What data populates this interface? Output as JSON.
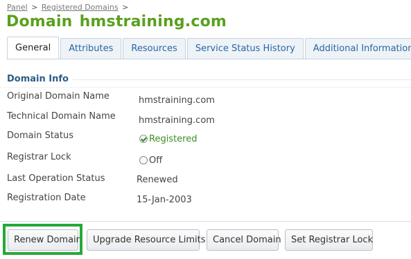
{
  "breadcrumb": {
    "items": [
      "Panel",
      "Registered Domains"
    ],
    "separator": ">"
  },
  "title": {
    "prefix": "Domain",
    "domain": "hmstraining.com",
    "color": "#5aa01e"
  },
  "tabs": [
    {
      "label": "General",
      "active": true
    },
    {
      "label": "Attributes",
      "active": false
    },
    {
      "label": "Resources",
      "active": false
    },
    {
      "label": "Service Status History",
      "active": false
    },
    {
      "label": "Additional Information",
      "active": false
    }
  ],
  "section": {
    "title": "Domain Info"
  },
  "fields": {
    "original_domain_name": {
      "label": "Original Domain Name",
      "value": "hmstraining.com"
    },
    "technical_domain_name": {
      "label": "Technical Domain Name",
      "value": "hmstraining.com"
    },
    "domain_status": {
      "label": "Domain Status",
      "value": "Registered",
      "icon": "check-circle-icon",
      "color": "#3b8f1f"
    },
    "registrar_lock": {
      "label": "Registrar Lock",
      "value": "Off",
      "icon": "empty-circle-icon"
    },
    "last_operation_status": {
      "label": "Last Operation Status",
      "value": "Renewed"
    },
    "registration_date": {
      "label": "Registration Date",
      "value": "15-Jan-2003"
    }
  },
  "buttons": {
    "renew": "Renew Domain",
    "upgrade": "Upgrade Resource Limits",
    "cancel": "Cancel Domain",
    "set_lock": "Set Registrar Lock"
  },
  "highlight_color": "#27a83a"
}
